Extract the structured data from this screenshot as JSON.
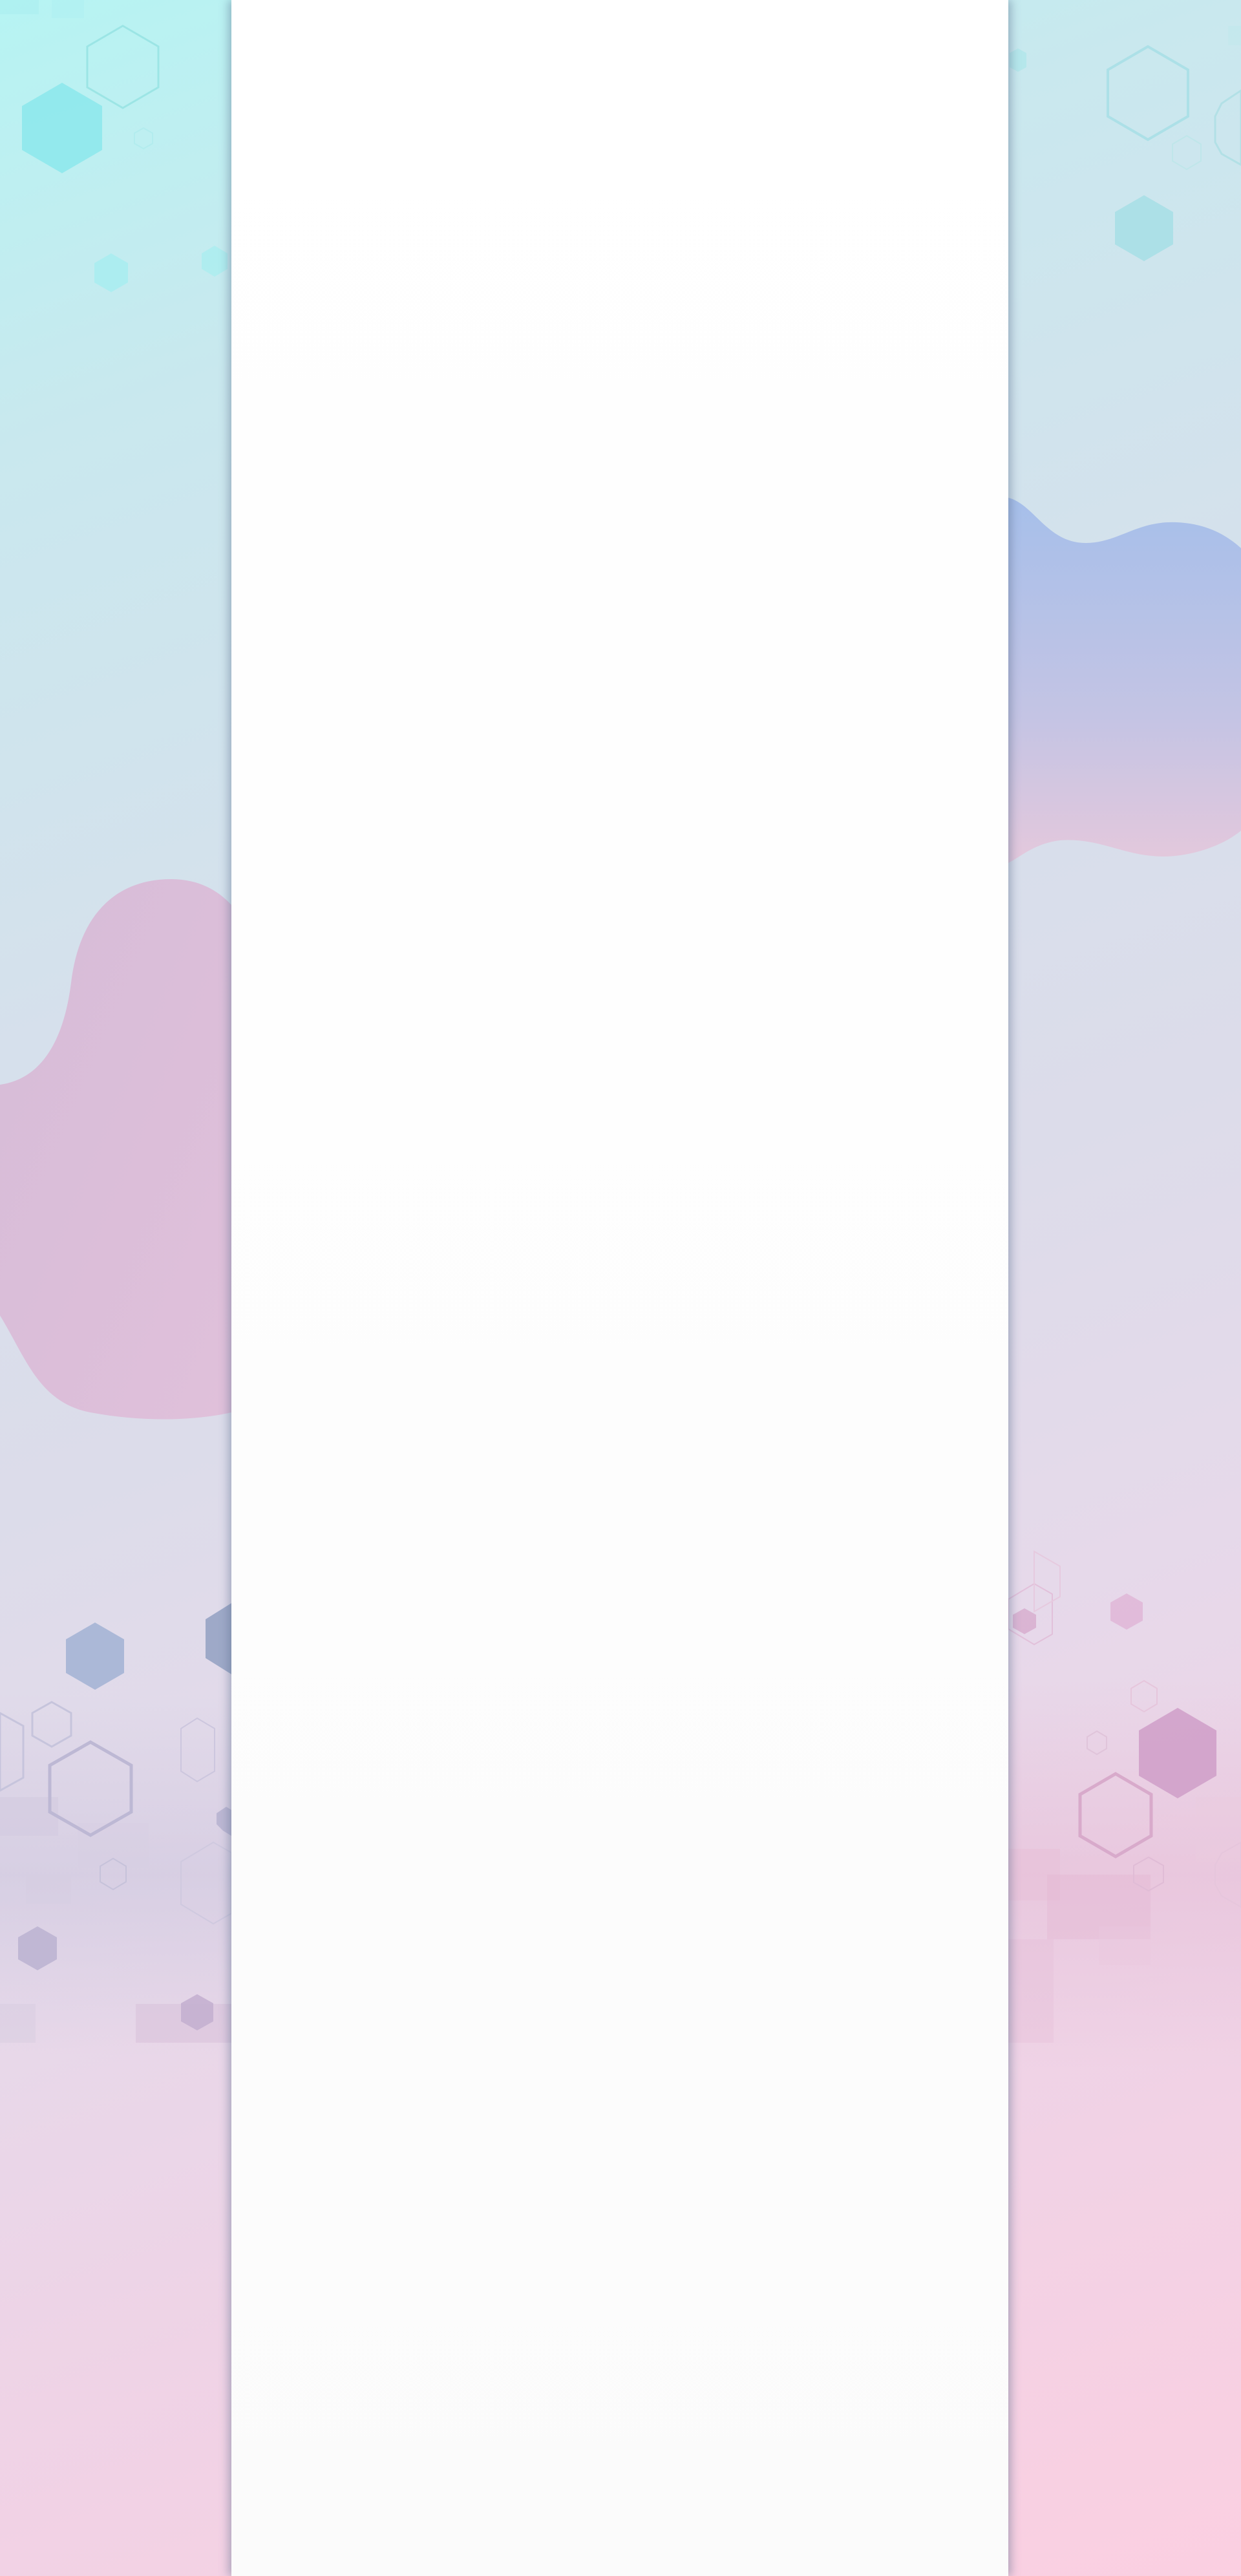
{
  "theme": {
    "background_top": "#b6f4f3",
    "background_middle": "#dcdcea",
    "background_bottom": "#fbcfe1",
    "content_panel": "#ffffff",
    "blob_pink": "#d8b8d8",
    "blob_blue": "#a8bde8",
    "hex_teal": "#8fe6ea",
    "hex_slate": "#9aa8c8",
    "hex_magenta": "#cf9ec8"
  },
  "decorations": {
    "left_blob": "pink-wave-blob",
    "right_blob": "blue-pink-wave-blob",
    "shapes": "hexagon-pattern"
  },
  "content": {}
}
